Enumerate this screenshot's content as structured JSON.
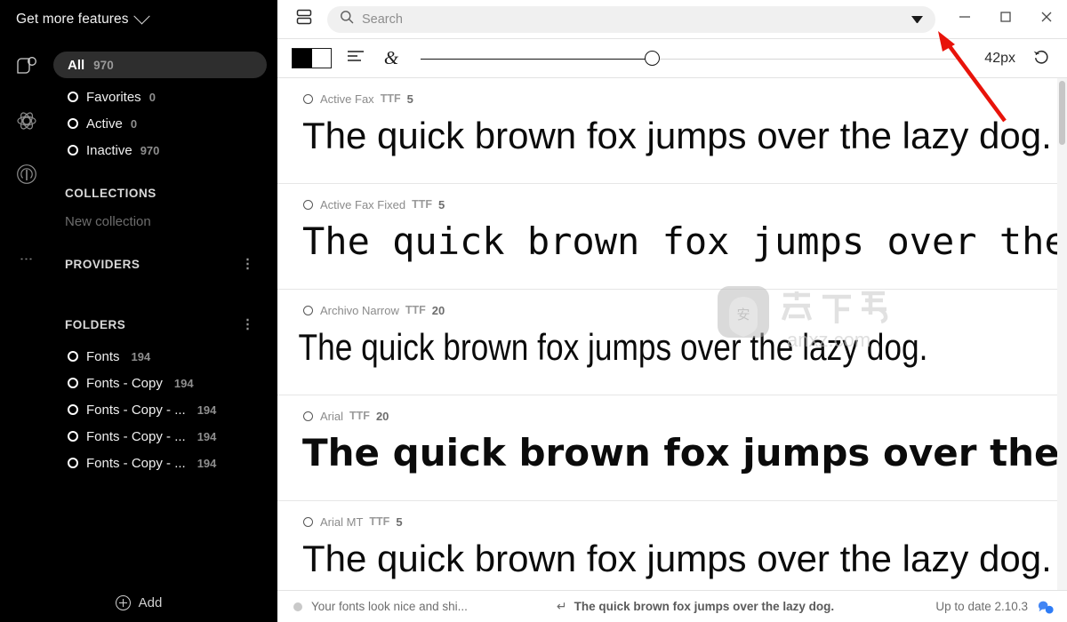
{
  "sidebar": {
    "promo": {
      "label": "Get more features",
      "icon": "chevron-down-icon"
    },
    "rail": [
      {
        "name": "fonts-icon"
      },
      {
        "name": "collections-atom-icon"
      },
      {
        "name": "providers-broadcast-icon"
      },
      {
        "name": "more-options-icon"
      }
    ],
    "filters": {
      "all": {
        "label": "All",
        "count": "970"
      },
      "items": [
        {
          "label": "Favorites",
          "count": "0"
        },
        {
          "label": "Active",
          "count": "0"
        },
        {
          "label": "Inactive",
          "count": "970"
        }
      ]
    },
    "collections": {
      "title": "COLLECTIONS",
      "new_item": "New collection"
    },
    "providers": {
      "title": "PROVIDERS",
      "menu": "⋮"
    },
    "folders": {
      "title": "FOLDERS",
      "menu": "⋮",
      "items": [
        {
          "label": "Fonts",
          "count": "194"
        },
        {
          "label": "Fonts - Copy",
          "count": "194"
        },
        {
          "label": "Fonts - Copy - ...",
          "count": "194"
        },
        {
          "label": "Fonts - Copy - ...",
          "count": "194"
        },
        {
          "label": "Fonts - Copy - ...",
          "count": "194"
        }
      ]
    },
    "add": {
      "label": "Add",
      "icon": "plus-circle-icon"
    }
  },
  "titlebar": {
    "panel_toggle": "panel-layout-icon",
    "search": {
      "placeholder": "Search",
      "value": "",
      "icon": "search-icon",
      "dropdown": "caret-down-icon"
    },
    "window": {
      "minimize": "minimize-icon",
      "maximize": "maximize-icon",
      "close": "close-icon"
    }
  },
  "toolbar": {
    "color_swatch": "black-white-swatch",
    "align_icon": "text-align-icon",
    "glyph_icon": "ampersand-icon",
    "size_slider": {
      "value": 42,
      "min": 8,
      "max": 120,
      "percent": 43
    },
    "size_label": "42px",
    "reset": {
      "label": "reset-size",
      "icon": "undo-icon"
    }
  },
  "fonts": {
    "sample_text": "The quick brown fox jumps over the lazy dog.",
    "rows": [
      {
        "name": "Active Fax",
        "format": "TTF",
        "count": "5",
        "style": "s-sans"
      },
      {
        "name": "Active Fax Fixed",
        "format": "TTF",
        "count": "5",
        "style": "s-mono"
      },
      {
        "name": "Archivo Narrow",
        "format": "TTF",
        "count": "20",
        "style": "s-narrow"
      },
      {
        "name": "Arial",
        "format": "TTF",
        "count": "20",
        "style": "s-bold"
      },
      {
        "name": "Arial MT",
        "format": "TTF",
        "count": "5",
        "style": "s-sans"
      }
    ]
  },
  "statusbar": {
    "message": "Your fonts look nice and shi...",
    "enter_glyph": "↵",
    "preview_text": "The quick brown fox jumps over the lazy dog.",
    "version": "Up to date 2.10.3",
    "bubble_icon": "chat-bubble-icon"
  },
  "watermark": {
    "cn": "安下载",
    "domain": "anxz.com"
  },
  "colors": {
    "sidebar_bg": "#000000",
    "accent_blue": "#3b78e7",
    "selected_pill": "#2e2e2e",
    "annotation_red": "#e8130a"
  }
}
